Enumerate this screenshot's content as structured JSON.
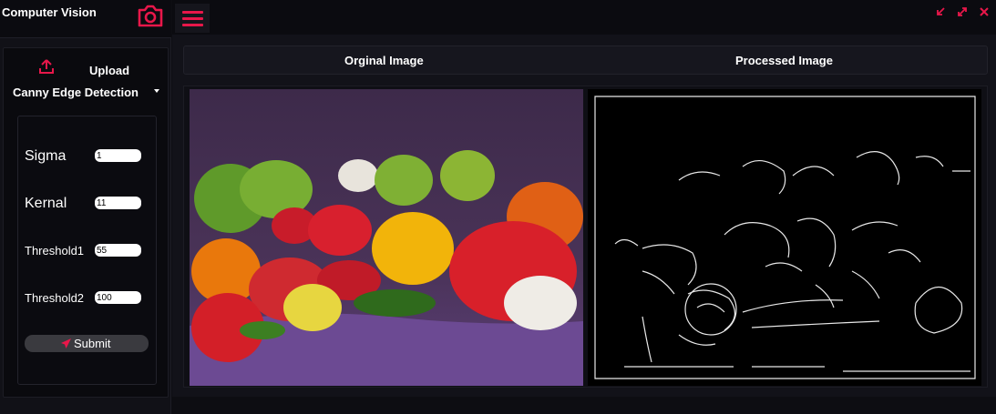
{
  "app": {
    "title": "Computer Vision",
    "camera_icon": "camera-icon",
    "accent_color": "#e8174a"
  },
  "sidebar": {
    "upload_label": "Upload",
    "upload_icon": "upload-icon",
    "algorithm_selected": "Canny Edge Detection",
    "params": [
      {
        "label": "Sigma",
        "value": "1"
      },
      {
        "label": "Kernal",
        "value": "11"
      },
      {
        "label": "Threshold1",
        "value": "55"
      },
      {
        "label": "Threshold2",
        "value": "100"
      }
    ],
    "submit_label": "Submit",
    "submit_icon": "send-icon"
  },
  "topbar": {
    "menu_icon": "hamburger-menu-icon",
    "window_controls": [
      "minimize-icon",
      "maximize-icon",
      "close-icon"
    ]
  },
  "main": {
    "original_header": "Orginal Image",
    "processed_header": "Processed Image"
  }
}
